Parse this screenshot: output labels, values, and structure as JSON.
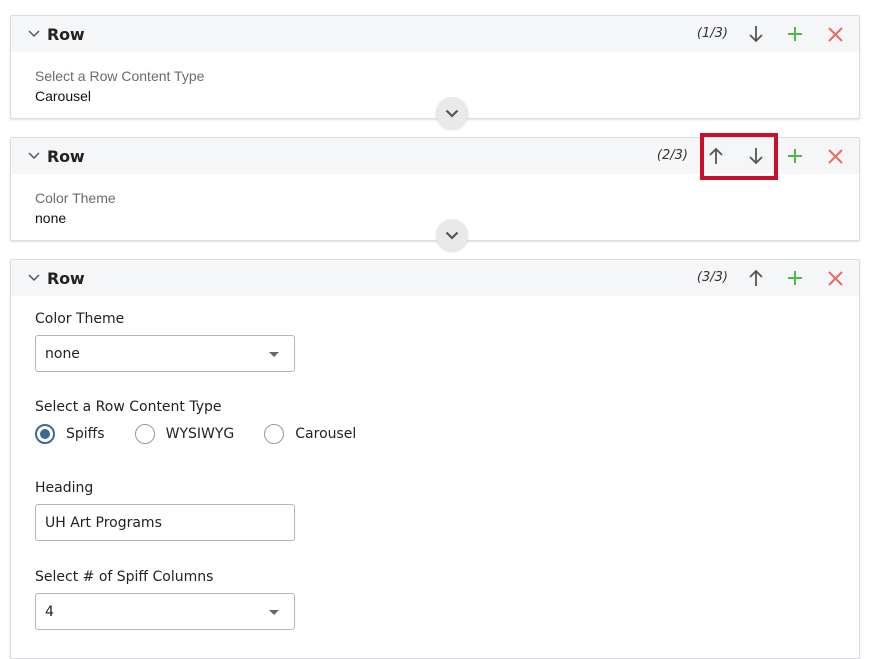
{
  "rows": [
    {
      "title": "Row",
      "counter": "(1/3)",
      "summary_label": "Select a Row Content Type",
      "summary_value": "Carousel",
      "actions": [
        "move-down",
        "add",
        "remove"
      ]
    },
    {
      "title": "Row",
      "counter": "(2/3)",
      "summary_label": "Color Theme",
      "summary_value": "none",
      "actions": [
        "move-up",
        "move-down",
        "add",
        "remove"
      ]
    },
    {
      "title": "Row",
      "counter": "(3/3)",
      "actions": [
        "move-up",
        "add",
        "remove"
      ],
      "fields": {
        "color_theme": {
          "label": "Color Theme",
          "value": "none"
        },
        "content_type": {
          "label": "Select a Row Content Type",
          "options": [
            "Spiffs",
            "WYSIWYG",
            "Carousel"
          ],
          "selected": "Spiffs"
        },
        "heading": {
          "label": "Heading",
          "value": "UH Art Programs"
        },
        "spiff_columns": {
          "label": "Select # of Spiff Columns",
          "value": "4"
        }
      }
    }
  ],
  "colors": {
    "add": "#4cb944",
    "remove": "#ec6a63",
    "arrow": "#555555",
    "highlight": "#c8102e",
    "radio_accent": "#3d6a95"
  }
}
